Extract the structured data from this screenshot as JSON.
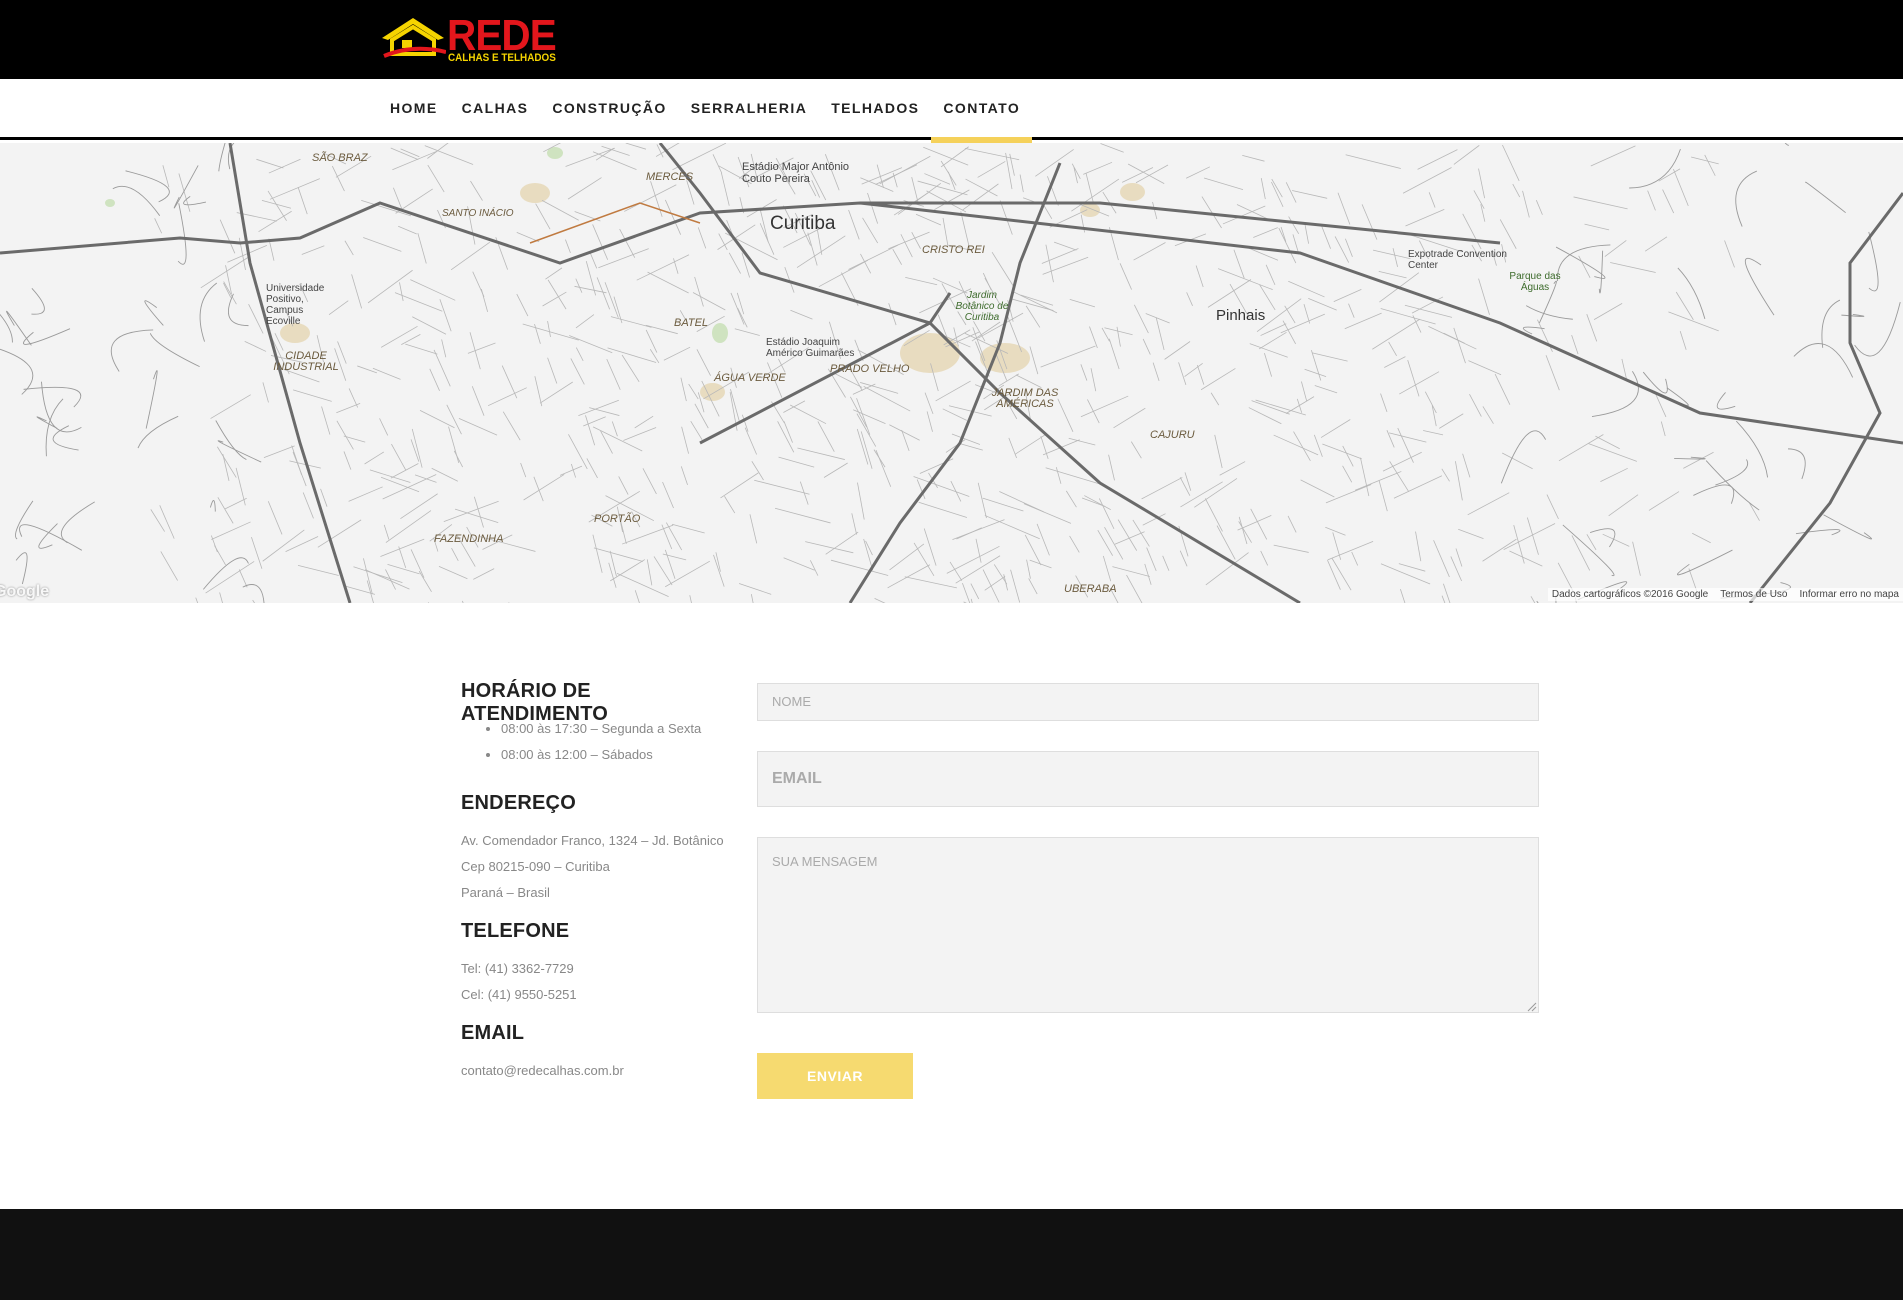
{
  "logo": {
    "text": "REDE",
    "subtitle": "CALHAS E TELHADOS"
  },
  "nav": {
    "items": [
      "HOME",
      "CALHAS",
      "CONSTRUÇÃO",
      "SERRALHERIA",
      "TELHADOS",
      "CONTATO"
    ],
    "active": "CONTATO"
  },
  "map": {
    "labels": {
      "city": "Curitiba",
      "pinhais": "Pinhais",
      "sao_braz": "SÃO BRAZ",
      "merces": "MERCES",
      "santo_inacio": "SANTO INÁCIO",
      "estadio_major": "Estádio Major Antônio Couto Pereira",
      "cristo_rei": "CRISTO REI",
      "jardim_botanico": "Jardim Botânico de Curitiba",
      "batel": "BATEL",
      "agua_verde": "ÁGUA VERDE",
      "prado_velho": "PRADO VELHO",
      "jardim_americas": "JARDIM DAS AMÉRICAS",
      "cajuru": "CAJURU",
      "cidade_industrial": "CIDADE INDUSTRIAL",
      "fazendinha": "FAZENDINHA",
      "portao": "PORTÃO",
      "uberaba": "UBERABA",
      "universidade": "Universidade Positivo, Campus Ecoville",
      "expotrade": "Expotrade Convention Center",
      "parque_aguas": "Parque das Águas",
      "estadio_joaquim": "Estádio Joaquim Américo Guimarães"
    },
    "attribution": [
      "Dados cartográficos ©2016 Google",
      "Termos de Uso",
      "Informar erro no mapa"
    ],
    "google_mark": "Google"
  },
  "info": {
    "hours_title": "HORÁRIO DE ATENDIMENTO",
    "hours": [
      "08:00 às 17:30 – Segunda a Sexta",
      "08:00 às 12:00 – Sábados"
    ],
    "address_title": "ENDEREÇO",
    "address": [
      "Av. Comendador Franco, 1324 – Jd. Botânico",
      "Cep 80215-090 – Curitiba",
      "Paraná – Brasil"
    ],
    "phone_title": "TELEFONE",
    "phones": [
      "Tel:  (41) 3362-7729",
      "Cel:  (41) 9550-5251"
    ],
    "email_title": "EMAIL",
    "email": "contato@redecalhas.com.br"
  },
  "form": {
    "name_placeholder": "NOME",
    "email_placeholder": "EMAIL",
    "message_placeholder": "SUA MENSAGEM",
    "submit_label": "ENVIAR"
  },
  "colors": {
    "accent": "#f5d15a",
    "brand_red": "#e3161c",
    "brand_yellow": "#f5d400"
  }
}
